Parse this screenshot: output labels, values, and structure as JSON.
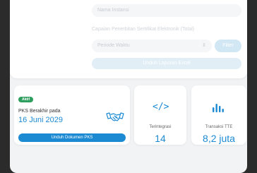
{
  "form": {
    "name_placeholder": "Nama Instansi",
    "cert_label": "Capaian Penerbitan Sertifikat Elektronik (Total)",
    "select_placeholder": "Periode Waktu",
    "small_button": "Filter",
    "wide_button": "Unduh Laporan Excel"
  },
  "pks": {
    "badge": "Aktif",
    "label": "PKS Berakhir pada",
    "date": "16 Juni 2029",
    "download": "Unduh Dokumen PKS"
  },
  "integration": {
    "label": "Terintegrasi",
    "value": "14"
  },
  "tte": {
    "label": "Transaksi TTE",
    "value": "8,2 juta"
  },
  "colors": {
    "accent": "#1c8ad3",
    "badge_green": "#2e9e5e",
    "background": "#f1f3f5"
  },
  "icons": {
    "handshake": "handshake-icon",
    "code": "code-icon",
    "chart": "bar-chart-icon"
  }
}
